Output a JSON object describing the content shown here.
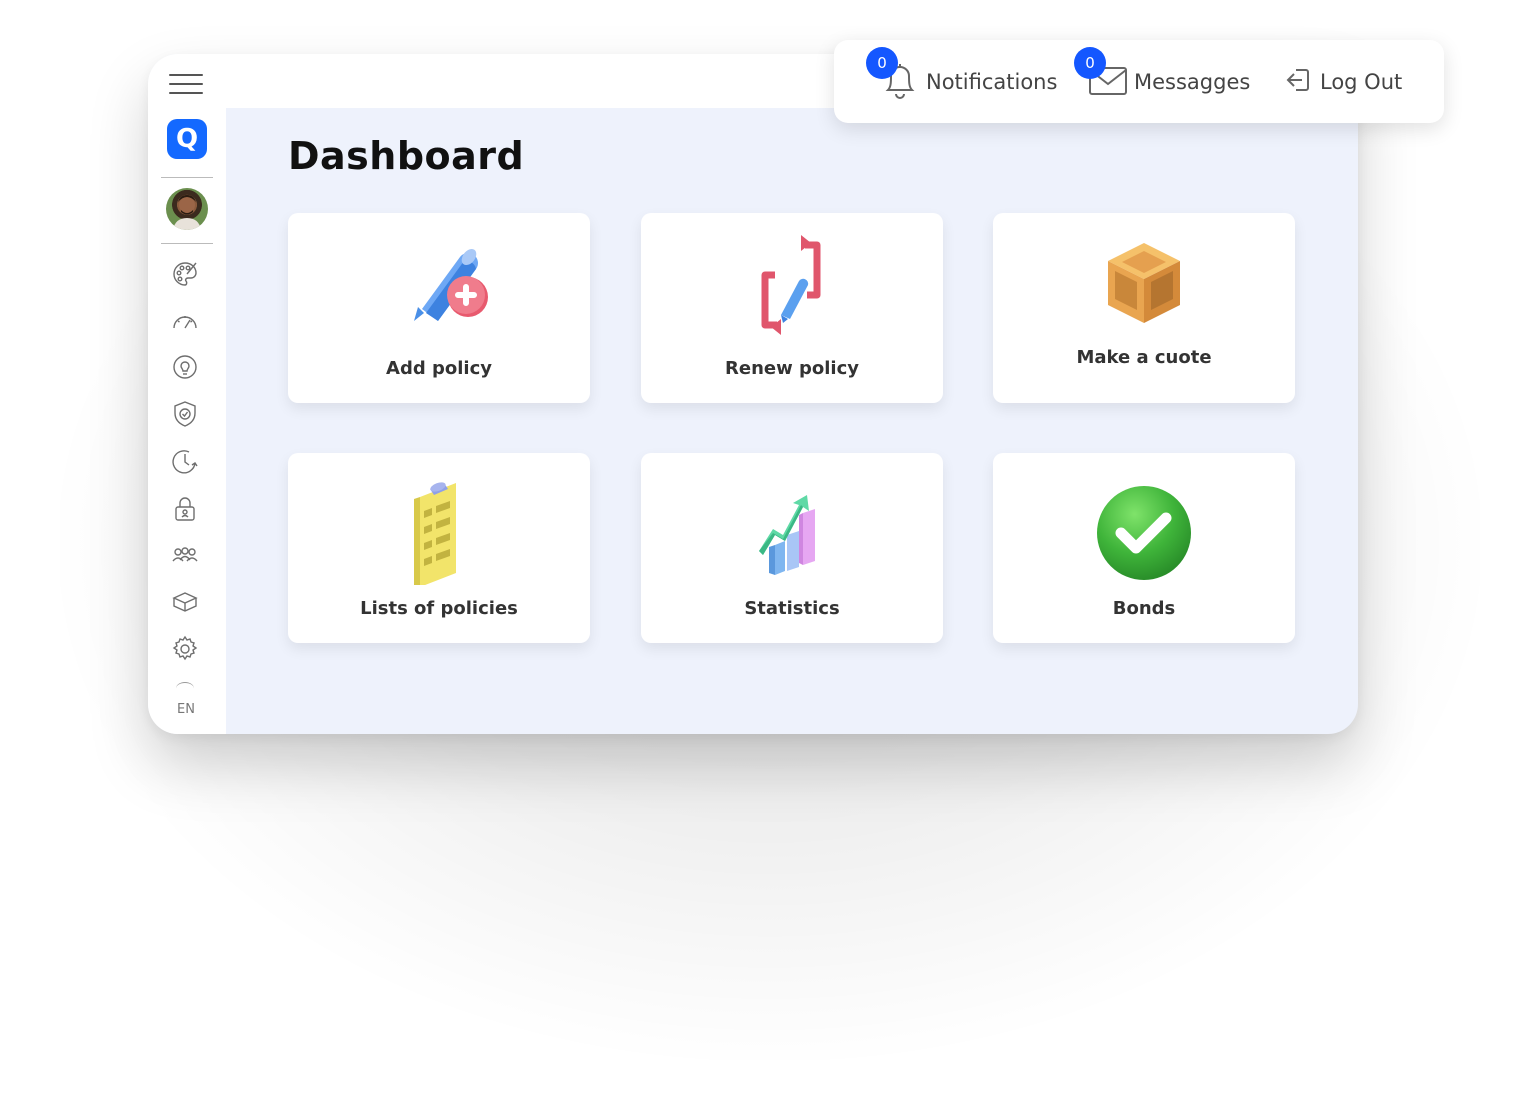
{
  "header": {
    "notifications": {
      "label": "Notifications",
      "count": "0"
    },
    "messages": {
      "label": "Messagges",
      "count": "0"
    },
    "logout": {
      "label": "Log Out"
    }
  },
  "sidebar": {
    "logo_glyph": "Q",
    "language": "EN",
    "icons": [
      "palette-icon",
      "speedometer-icon",
      "lightbulb-icon",
      "shield-check-icon",
      "clock-icon",
      "lock-icon",
      "users-icon",
      "box-icon",
      "settings-icon"
    ]
  },
  "main": {
    "title": "Dashboard",
    "cards": [
      {
        "label": "Add policy"
      },
      {
        "label": "Renew policy"
      },
      {
        "label": "Make a cuote"
      },
      {
        "label": "Lists of policies"
      },
      {
        "label": "Statistics"
      },
      {
        "label": "Bonds"
      }
    ]
  },
  "colors": {
    "accent": "#1469ff",
    "badge": "#1457ff",
    "content_bg": "#eef2fc"
  }
}
